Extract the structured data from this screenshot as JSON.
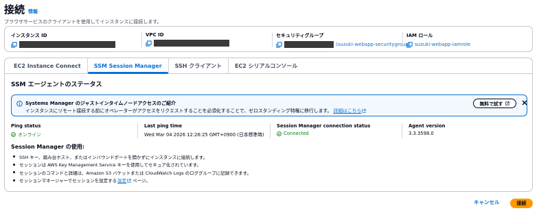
{
  "header": {
    "title": "接続",
    "info_link": "情報",
    "description": "ブラウザサービスのクライアントを使用してインスタンスに接続します。"
  },
  "summary": {
    "instance_id_label": "インスタンス ID",
    "vpc_id_label": "VPC ID",
    "security_group_label": "セキュリティグループ",
    "security_group_name": "(suzuki-webapp-securitygroup)",
    "iam_role_label": "IAM ロール",
    "iam_role_value": "suzuki-webapp-iamrole"
  },
  "tabs": [
    {
      "label": "EC2 Instance Connect"
    },
    {
      "label": "SSM Session Manager"
    },
    {
      "label": "SSH クライアント"
    },
    {
      "label": "EC2 シリアルコンソール"
    }
  ],
  "section": {
    "title": "SSM エージェントのステータス"
  },
  "alert": {
    "title": "Systems Manager のジャストインタイムノードアクセスのご紹介",
    "body": "インスタンスにリモート接続する前にオペレーターがアクセスをリクエストすることを必須化することで、ゼロスタンディング特権に移行します。",
    "link": "詳細はこちら",
    "trial_button": "無料で試す"
  },
  "status": {
    "ping_label": "Ping status",
    "ping_value": "オンライン",
    "last_ping_label": "Last ping time",
    "last_ping_value": "Wed Mar 04 2026 12:26:25 GMT+0900 (日本標準時)",
    "connection_label": "Session Manager connection status",
    "connection_value": "Connected",
    "agent_label": "Agent version",
    "agent_value": "3.3.3598.0"
  },
  "usage": {
    "title": "Session Manager の使用:",
    "items": [
      "SSH キー、踏み台ホスト、またはインバウンドポートを開かずにインスタンスに接続します。",
      "セッションは AWS Key Management Service キーを使用してセキュア化されています。",
      "セッションのコマンドと詳細は、Amazon S3 バケットまたは CloudWatch Logs のロググループに記録できます。"
    ],
    "last_item_prefix": "セッションマネージャーでセッションを設定する",
    "last_item_link": "設定",
    "last_item_suffix": "ページ。"
  },
  "footer": {
    "cancel": "キャンセル",
    "connect": "接続"
  },
  "colors": {
    "accent": "#0972d3",
    "success": "#037f0c",
    "primary_button": "#ff9900"
  }
}
